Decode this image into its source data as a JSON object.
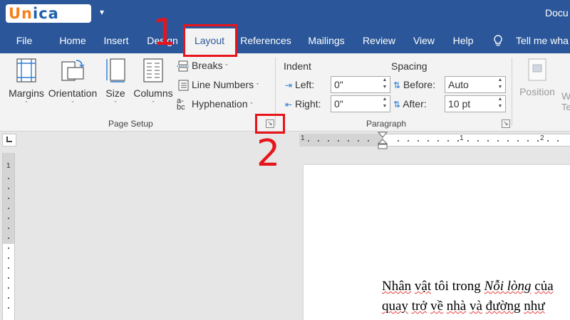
{
  "titlebar": {
    "logo_text": "Unica",
    "quick_access": "▾",
    "doc_title": "Docu"
  },
  "tabs": [
    {
      "label": "File"
    },
    {
      "label": "Home"
    },
    {
      "label": "Insert"
    },
    {
      "label": "Design"
    },
    {
      "label": "Layout"
    },
    {
      "label": "References"
    },
    {
      "label": "Mailings"
    },
    {
      "label": "Review"
    },
    {
      "label": "View"
    },
    {
      "label": "Help"
    }
  ],
  "tell_me": "Tell me wha",
  "page_setup": {
    "margins": "Margins",
    "orientation": "Orientation",
    "size": "Size",
    "columns": "Columns",
    "breaks": "Breaks",
    "line_numbers": "Line Numbers",
    "hyphenation": "Hyphenation",
    "group_label": "Page Setup",
    "chevron": "ˇ"
  },
  "paragraph": {
    "indent_header": "Indent",
    "spacing_header": "Spacing",
    "left_label": "Left:",
    "right_label": "Right:",
    "before_label": "Before:",
    "after_label": "After:",
    "left_value": "0\"",
    "right_value": "0\"",
    "before_value": "Auto",
    "after_value": "10 pt",
    "group_label": "Paragraph"
  },
  "arrange": {
    "position": "Position",
    "wrap_partial": "W",
    "text_partial": "Te"
  },
  "annotations": {
    "step1": "1",
    "step2": "2"
  },
  "ruler": {
    "h_labels": [
      "1",
      "1",
      "2"
    ],
    "v_label": "1"
  },
  "document": {
    "line1_a": "Nhân",
    "line1_b": "vật",
    "line1_c": "tôi trong",
    "line1_d": "Nỗi lòng",
    "line1_e": "của",
    "line2_a": "quay",
    "line2_b": "trở",
    "line2_c": "về",
    "line2_d": "nhà",
    "line2_e": "và",
    "line2_f": "đường",
    "line2_g": "như"
  },
  "colors": {
    "word_blue": "#2b579a",
    "annotation_red": "#e8141b",
    "logo_orange": "#f4801f",
    "logo_blue": "#1f61ac"
  }
}
